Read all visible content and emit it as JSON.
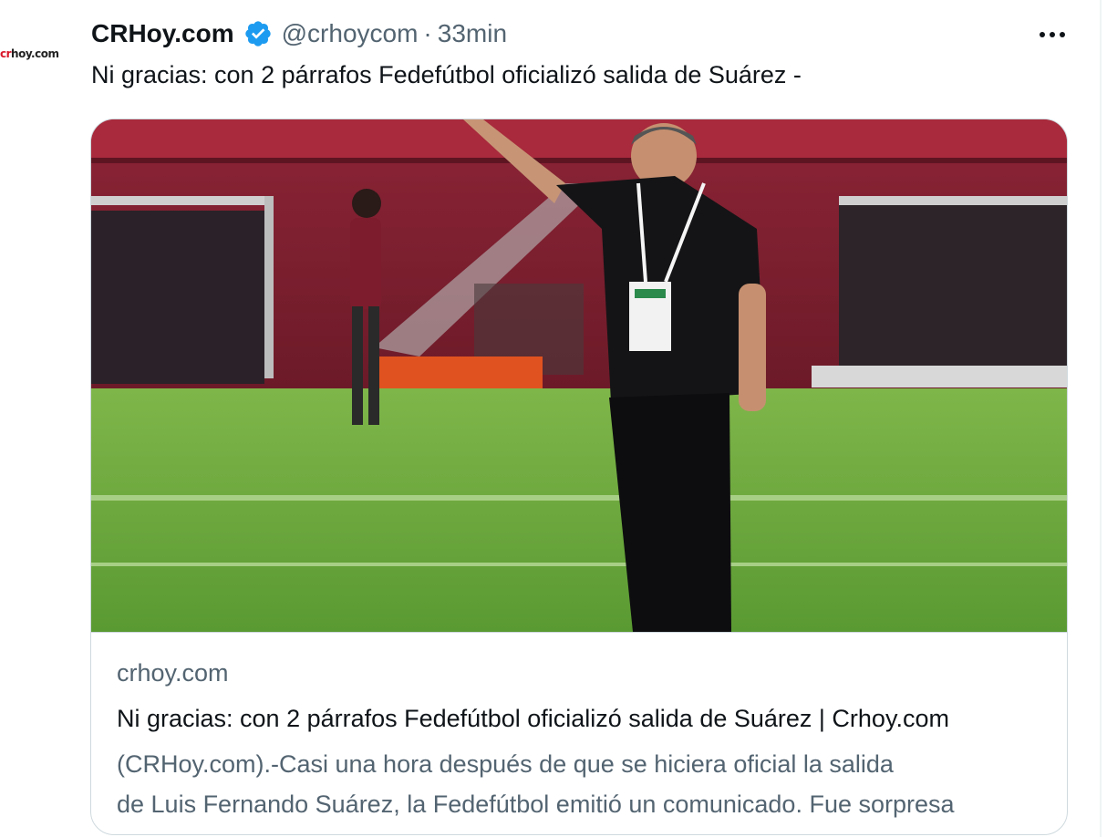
{
  "tweet": {
    "author": {
      "display_name": "CRHoy.com",
      "handle": "@crhoycom",
      "avatar_logo": {
        "r": "cr",
        "rest": "hoy.com"
      }
    },
    "separator": "·",
    "time": "33min",
    "text": "Ni gracias: con 2 párrafos Fedefútbol oficializó salida de Suárez -",
    "more_label": "···"
  },
  "card": {
    "domain": "crhoy.com",
    "title": "Ni gracias: con 2 párrafos Fedefútbol oficializó salida de Suárez | Crhoy.com",
    "description_line1": "(CRHoy.com).-Casi una hora después de que se hiciera oficial la salida",
    "description_line2": "de Luis Fernando Suárez, la Fedefútbol emitió un comunicado. Fue sorpresa"
  },
  "colors": {
    "text_primary": "#0f1419",
    "text_secondary": "#536471",
    "verified_blue": "#1d9bf0",
    "card_border": "#cfd9de",
    "brand_red": "#d8172a"
  }
}
